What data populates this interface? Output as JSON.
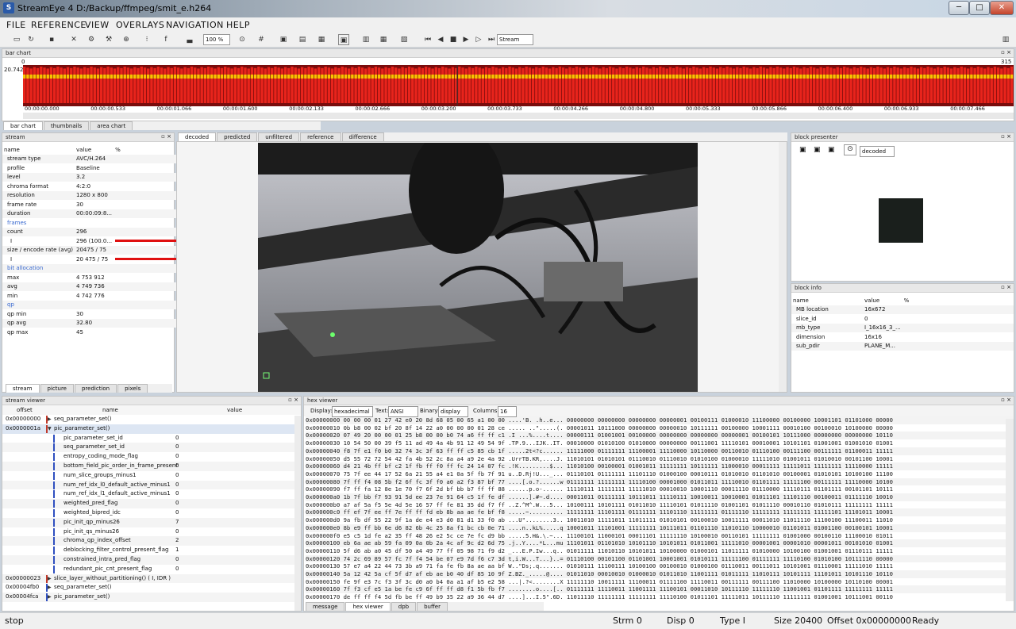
{
  "window": {
    "title": "StreamEye 4 D:/Backup/ffmpeg/smit_e.h264",
    "minimize": "─",
    "maximize": "□",
    "close": "✕"
  },
  "menu": [
    "FILE",
    "REFERENCE",
    "VIEW",
    "OVERLAYS",
    "NAVIGATION",
    "HELP"
  ],
  "toolbar": {
    "zoom": "100 %",
    "mode": "Stream"
  },
  "barchart": {
    "title": "bar chart",
    "y_max_label": "20.742",
    "x_start": "0",
    "x_end": "315",
    "times": [
      "00:00:00.000",
      "00:00:00.533",
      "00:00:01.066",
      "00:00:01.600",
      "00:00:02.133",
      "00:00:02.666",
      "00:00:03.200",
      "00:00:03.733",
      "00:00:04.266",
      "00:00:04.800",
      "00:00:05.333",
      "00:00:05.866",
      "00:00:06.400",
      "00:00:06.933",
      "00:00:07.466"
    ],
    "tabs": [
      "bar chart",
      "thumbnails",
      "area chart"
    ],
    "colors": {
      "bar": "#e8241c",
      "bg": "#8a1010",
      "band": "#f7c400"
    }
  },
  "stream": {
    "title": "stream",
    "headers": [
      "name",
      "value",
      "%"
    ],
    "rows": [
      {
        "n": "stream type",
        "v": "AVC/H.264",
        "s": false
      },
      {
        "n": "profile",
        "v": "Baseline",
        "s": false
      },
      {
        "n": "level",
        "v": "3.2",
        "s": false
      },
      {
        "n": "chroma format",
        "v": "4:2:0",
        "s": false
      },
      {
        "n": "resolution",
        "v": "1280 x 800",
        "s": false
      },
      {
        "n": "frame rate",
        "v": "30",
        "s": false
      },
      {
        "n": "duration",
        "v": "00:00:09:8...",
        "s": false
      },
      {
        "n": "frames",
        "v": "",
        "s": true
      },
      {
        "n": "count",
        "v": "296",
        "s": false,
        "i": 1
      },
      {
        "n": "I",
        "v": "296 (100.0...",
        "s": false,
        "i": 2,
        "bar": true
      },
      {
        "n": "size / encode rate (avg)",
        "v": "20475 / 75",
        "s": false,
        "i": 1
      },
      {
        "n": "I",
        "v": "20 475 / 75",
        "s": false,
        "i": 2,
        "bar": true
      },
      {
        "n": "bit allocation",
        "v": "",
        "s": true
      },
      {
        "n": "max",
        "v": "4 753 912",
        "s": false,
        "i": 1
      },
      {
        "n": "avg",
        "v": "4 749 736",
        "s": false,
        "i": 1
      },
      {
        "n": "min",
        "v": "4 742 776",
        "s": false,
        "i": 1
      },
      {
        "n": "qp",
        "v": "",
        "s": true
      },
      {
        "n": "qp min",
        "v": "30",
        "s": false,
        "i": 1
      },
      {
        "n": "qp avg",
        "v": "32.80",
        "s": false,
        "i": 1
      },
      {
        "n": "qp max",
        "v": "45",
        "s": false,
        "i": 1
      }
    ],
    "tabs": [
      "stream",
      "picture",
      "prediction",
      "pixels"
    ]
  },
  "viewer": {
    "tabs": [
      "decoded",
      "predicted",
      "unfiltered",
      "reference",
      "difference"
    ]
  },
  "block_presenter": {
    "title": "block presenter",
    "mode": "decoded"
  },
  "block_info": {
    "title": "block info",
    "headers": [
      "name",
      "value",
      "%"
    ],
    "rows": [
      [
        "MB location",
        "16x672"
      ],
      [
        "slice_id",
        "0"
      ],
      [
        "mb_type",
        "I_16x16_3_..."
      ],
      [
        "dimension",
        "16x16"
      ],
      [
        "sub_pdir",
        "PLANE_M..."
      ]
    ]
  },
  "stream_viewer": {
    "title": "stream viewer",
    "headers": [
      "offset",
      "name",
      "value"
    ],
    "rows": [
      {
        "o": "0x00000000",
        "n": "seq_parameter_set()",
        "v": "",
        "lvl": 0,
        "exp": false,
        "c": "#c0392b"
      },
      {
        "o": "0x0000001a",
        "n": "pic_parameter_set()",
        "v": "",
        "lvl": 0,
        "exp": true,
        "c": "#c0392b"
      },
      {
        "o": "",
        "n": "pic_parameter_set_id",
        "v": "0",
        "lvl": 1
      },
      {
        "o": "",
        "n": "seq_parameter_set_id",
        "v": "0",
        "lvl": 1
      },
      {
        "o": "",
        "n": "entropy_coding_mode_flag",
        "v": "0",
        "lvl": 1
      },
      {
        "o": "",
        "n": "bottom_field_pic_order_in_frame_present",
        "v": "0",
        "lvl": 1
      },
      {
        "o": "",
        "n": "num_slice_groups_minus1",
        "v": "0",
        "lvl": 1
      },
      {
        "o": "",
        "n": "num_ref_idx_l0_default_active_minus1",
        "v": "0",
        "lvl": 1
      },
      {
        "o": "",
        "n": "num_ref_idx_l1_default_active_minus1",
        "v": "0",
        "lvl": 1
      },
      {
        "o": "",
        "n": "weighted_pred_flag",
        "v": "0",
        "lvl": 1
      },
      {
        "o": "",
        "n": "weighted_bipred_idc",
        "v": "0",
        "lvl": 1
      },
      {
        "o": "",
        "n": "pic_init_qp_minus26",
        "v": "7",
        "lvl": 1
      },
      {
        "o": "",
        "n": "pic_init_qs_minus26",
        "v": "0",
        "lvl": 1
      },
      {
        "o": "",
        "n": "chroma_qp_index_offset",
        "v": "2",
        "lvl": 1
      },
      {
        "o": "",
        "n": "deblocking_filter_control_present_flag",
        "v": "1",
        "lvl": 1
      },
      {
        "o": "",
        "n": "constrained_intra_pred_flag",
        "v": "0",
        "lvl": 1
      },
      {
        "o": "",
        "n": "redundant_pic_cnt_present_flag",
        "v": "0",
        "lvl": 1
      },
      {
        "o": "0x00000023",
        "n": "slice_layer_without_partitioning() ( I, IDR )",
        "v": "",
        "lvl": 0,
        "exp": false,
        "c": "#c0392b"
      },
      {
        "o": "0x00004fb0",
        "n": "seq_parameter_set()",
        "v": "",
        "lvl": 0,
        "exp": false,
        "c": "#3050c0"
      },
      {
        "o": "0x00004fca",
        "n": "pic_parameter_set()",
        "v": "",
        "lvl": 0,
        "exp": false,
        "c": "#3050c0"
      }
    ]
  },
  "hex_viewer": {
    "title": "hex viewer",
    "display_label": "Display:",
    "display": "hexadecimal",
    "text_label": "Text:",
    "text": "ANSI",
    "binary_label": "Binary:",
    "binary": "display",
    "columns_label": "Columns:",
    "columns": "16",
    "lines": [
      "0x00000000 00 00 00 01 27 42 e0 20 8d 68 05 00 65 a1 00 00 ....'B. .h..e... 00000000 00000000 00000000 00000001 00100111 01000010 11100000 00100000 10001101 01101000 00000",
      "0x00000010 0b b8 00 02 bf 20 8f 14 22 a0 00 00 00 01 28 ce ..... ..\".....(. 00001011 10111000 00000000 00000010 10111111 00100000 10001111 00010100 00100010 10100000 00000",
      "0x00000020 07 49 20 00 00 01 25 b8 00 00 b0 74 a6 ff ff c1 .I ...%....t.... 00000111 01001001 00100000 00000000 00000000 00000001 00100101 10111000 00000000 00000000 10110",
      "0x00000030 10 54 50 00 39 f5 11 ad 49 4a 4b 91 12 49 54 9f .TP.9...IJK..IT. 00010000 01010100 01010000 00000000 00111001 11110101 00010001 10101101 01001001 01001010 01001",
      "0x00000040 f8 7f e1 f0 b0 32 74 3c 3f 63 ff ff c5 85 cb 1f .....2t<?c...... 11111000 01111111 11100001 11110000 10110000 00110010 01110100 00111100 00111111 01100011 11111",
      "0x00000050 d5 55 72 72 54 42 fa 4b 52 2c 8a a4 a9 2e 4a 92 .UrrTB.KR,....J. 11010101 01010101 01110010 01110010 01010100 01000010 11111010 01001011 01010010 00101100 10001",
      "0x00000060 d4 21 4b ff bf c2 1f fb ff f0 ff fc 24 14 07 fc .!K.........$... 11010100 00100001 01001011 11111111 10111111 11000010 00011111 11111011 11111111 11110000 11111",
      "0x00000070 75 7f ee 44 17 52 6a 21 55 a4 e1 0a 5f fb 7f 91 u..D.Rj!U..._... 01110101 01111111 11101110 01000100 00010111 01010010 01101010 00100001 01010101 10100100 11100",
      "0x00000080 7f ff f4 08 5b f2 6f fc 3f f0 a0 a2 f3 87 bf 77 ....[.o.?......w 01111111 11111111 11110100 00001000 01011011 11110010 01101111 11111100 00111111 11110000 10100",
      "0x00000090 f7 ff fa 12 8e 1e 70 f7 6f 2d bf bb b7 ff ff 88 ......p.o-...... 11110111 11111111 11111010 00010010 10001110 00011110 01110000 11110111 01101111 00101101 10111",
      "0x000000a0 1b 7f bb f7 93 91 5d ee 23 7e 91 64 c5 1f fe df ......].#~.d.... 00011011 01111111 10111011 11110111 10010011 10010001 01011101 11101110 00100011 01111110 10010",
      "0x000000b0 a7 af 5a f5 5e 4d 5e 16 57 ff fe 81 35 dd f7 ff ..Z.^M^.W...5... 10100111 10101111 01011010 11110101 01011110 01001101 01011110 00010110 01010111 11111111 11111",
      "0x000000c0 ff ef 7f ee ff 7e ff ff fd eb 8b aa ae fe bf f8 .....~.......... 11111111 11101111 01111111 11101110 11111111 01111110 11111111 11111111 11111101 11101011 10001",
      "0x000000d0 9a fb df 55 22 9f 1a de e4 e3 d0 81 d1 33 f0 ab ...U\"........3.. 10011010 11111011 11011111 01010101 00100010 10011111 00011010 11011110 11100100 11100011 11010",
      "0x000000e0 8b e9 ff bb 6e d6 82 6b 4c 25 8a f1 bc cb 0e 71 ....n..kL%.....q 10001011 11101001 11111111 10111011 01101110 11010110 10000010 01101011 01001100 00100101 10001",
      "0x000000f0 e5 c5 1d fe a2 35 ff 48 26 e2 5c ce 7e fc d9 bb .....5.H&.\\.~... 11100101 11000101 00011101 11111110 10100010 00110101 11111111 01001000 00100110 11100010 01011",
      "0x00000100 eb 6a ae ab 59 fa 09 0a 0b 2a 4c af 9c d2 6d 75 .j..Y....*L...mu 11101011 01101010 10101110 10101011 01011001 11111010 00001001 00001010 00001011 00101010 01001",
      "0x00000110 5f d6 ab a0 45 df 50 a4 49 77 ff 05 98 71 f9 d2 _...E.P.Iw...q.. 01011111 11010110 10101011 10100000 01000101 11011111 01010000 10100100 01001001 01110111 11111",
      "0x00000120 74 2c 69 89 57 fc 7f f4 54 be 07 e9 7d f6 c7 3d t,i.W...T...}..= 01110100 00101100 01101001 10001001 01010111 11111100 01111111 11110100 01010100 10111110 00000",
      "0x00000130 57 e7 a4 22 44 73 3b a9 71 fa fe fb 8a ae aa bf W..\"Ds;.q....... 01010111 11100111 10100100 00100010 01000100 01110011 00111011 10101001 01110001 11111010 11111",
      "0x00000140 5a 12 42 5a cf 5f d7 af eb ae b0 40 df 85 10 9f Z.BZ._.....@.... 01011010 00010010 01000010 01011010 11001111 01011111 11010111 10101111 11101011 10101110 10110",
      "0x00000150 fe 9f e3 7c f3 3f 3c d0 a0 b4 0a a1 af b5 e2 58 ...|.?<........X 11111110 10011111 11100011 01111100 11110011 00111111 00111100 11010000 10100000 10110100 00001",
      "0x00000160 7f f3 cf e5 1a be fe c9 6f ff ff d8 f1 5b fb f7 ........o....[.. 01111111 11110011 11001111 11100101 00011010 10111110 11111110 11001001 01101111 11111111 11111",
      "0x00000170 de ff ff f4 5d fb be ff 49 b9 35 22 a9 36 44 d7 ....]...I.5\".6D. 11011110 11111111 11111111 11110100 01011101 11111011 10111110 11111111 01001001 10111001 00110"
    ],
    "tabs": [
      "message",
      "hex viewer",
      "dpb",
      "buffer"
    ]
  },
  "status": {
    "state": "stop",
    "strm": "Strm 0",
    "disp": "Disp 0",
    "type": "Type I",
    "size": "Size 20400",
    "offset": "Offset 0x00000000",
    "ready": "Ready"
  }
}
